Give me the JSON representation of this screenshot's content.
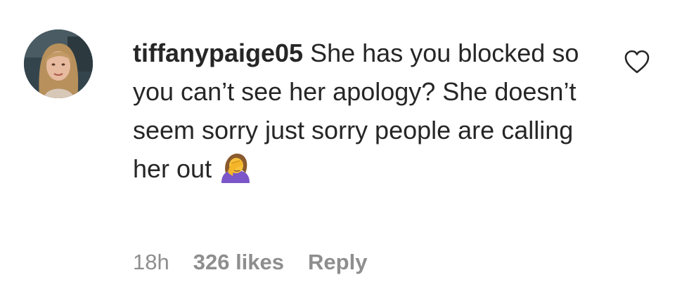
{
  "comment": {
    "username": "tiffanypaige05",
    "text": "She has you blocked so you can’t see her apology? She doesn’t seem sorry just sorry people are calling her out",
    "emoji_icon": "woman-facepalming-icon",
    "time": "18h",
    "likes": "326 likes",
    "reply_label": "Reply",
    "like_icon": "heart-outline-icon"
  },
  "colors": {
    "text": "#262626",
    "secondary_text": "#8e8e8e",
    "background": "#ffffff"
  }
}
